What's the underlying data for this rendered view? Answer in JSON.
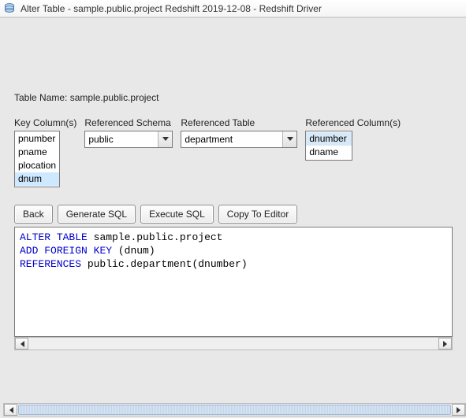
{
  "window": {
    "title": "Alter Table - sample.public.project Redshift 2019-12-08 - Redshift Driver"
  },
  "table_name_label": "Table Name: ",
  "table_name_value": "sample.public.project",
  "headers": {
    "key_columns": "Key Column(s)",
    "ref_schema": "Referenced Schema",
    "ref_table": "Referenced Table",
    "ref_columns": "Referenced Column(s)"
  },
  "key_columns": {
    "items": [
      "pnumber",
      "pname",
      "plocation",
      "dnum"
    ],
    "selected_index": 3
  },
  "ref_schema": {
    "value": "public"
  },
  "ref_table": {
    "value": "department"
  },
  "ref_columns": {
    "items": [
      "dnumber",
      "dname"
    ],
    "selected_index": 0
  },
  "buttons": {
    "back": "Back",
    "generate": "Generate SQL",
    "execute": "Execute SQL",
    "copy": "Copy To Editor"
  },
  "sql": {
    "line1_kw1": "ALTER",
    "line1_kw2": "TABLE",
    "line1_rest": " sample.public.project",
    "line2_kw1": "ADD",
    "line2_kw2": "FOREIGN",
    "line2_kw3": "KEY",
    "line2_rest": " (dnum)",
    "line3_kw1": "REFERENCES",
    "line3_rest": " public.department(dnumber)"
  }
}
